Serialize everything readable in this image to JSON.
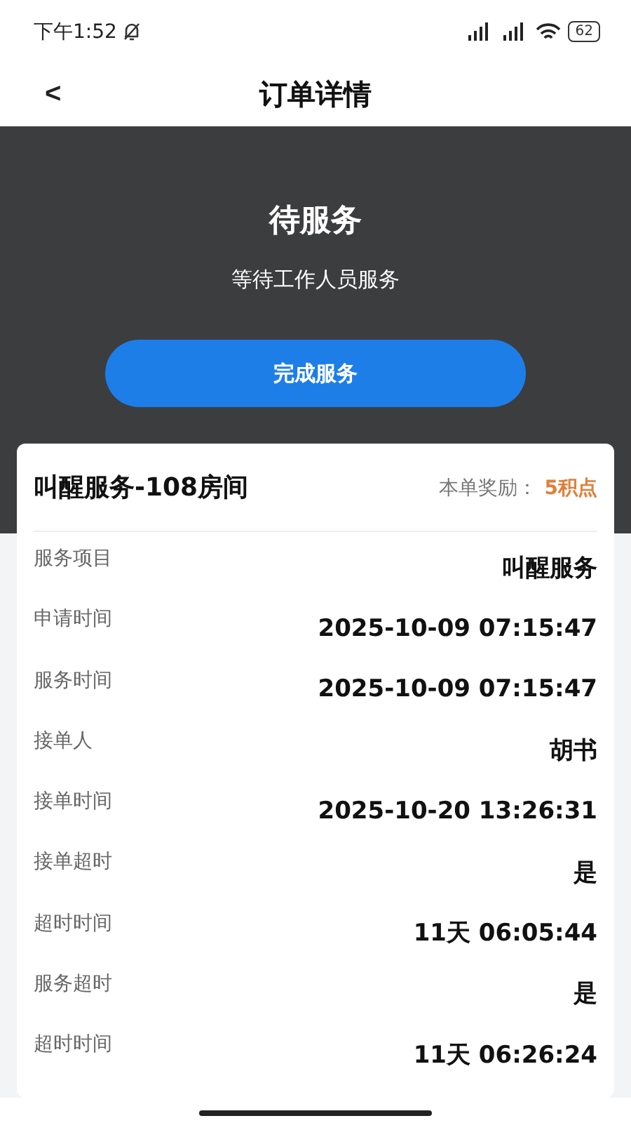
{
  "status_bar": {
    "time": "下午1:52",
    "battery": "62"
  },
  "nav": {
    "back": "<",
    "title": "订单详情"
  },
  "header": {
    "status": "待服务",
    "subtitle": "等待工作人员服务",
    "action": "完成服务"
  },
  "order": {
    "title": "叫醒服务-108房间",
    "reward_label": "本单奖励：",
    "reward_value": "5积点",
    "fields": [
      {
        "label": "服务项目",
        "value": "叫醒服务"
      },
      {
        "label": "申请时间",
        "value": "2025-10-09 07:15:47"
      },
      {
        "label": "服务时间",
        "value": "2025-10-09 07:15:47"
      },
      {
        "label": "接单人",
        "value": "胡书"
      },
      {
        "label": "接单时间",
        "value": "2025-10-20 13:26:31"
      },
      {
        "label": "接单超时",
        "value": "是"
      },
      {
        "label": "超时时间",
        "value": "11天 06:05:44"
      },
      {
        "label": "服务超时",
        "value": "是"
      },
      {
        "label": "超时时间",
        "value": "11天 06:26:24"
      }
    ]
  }
}
